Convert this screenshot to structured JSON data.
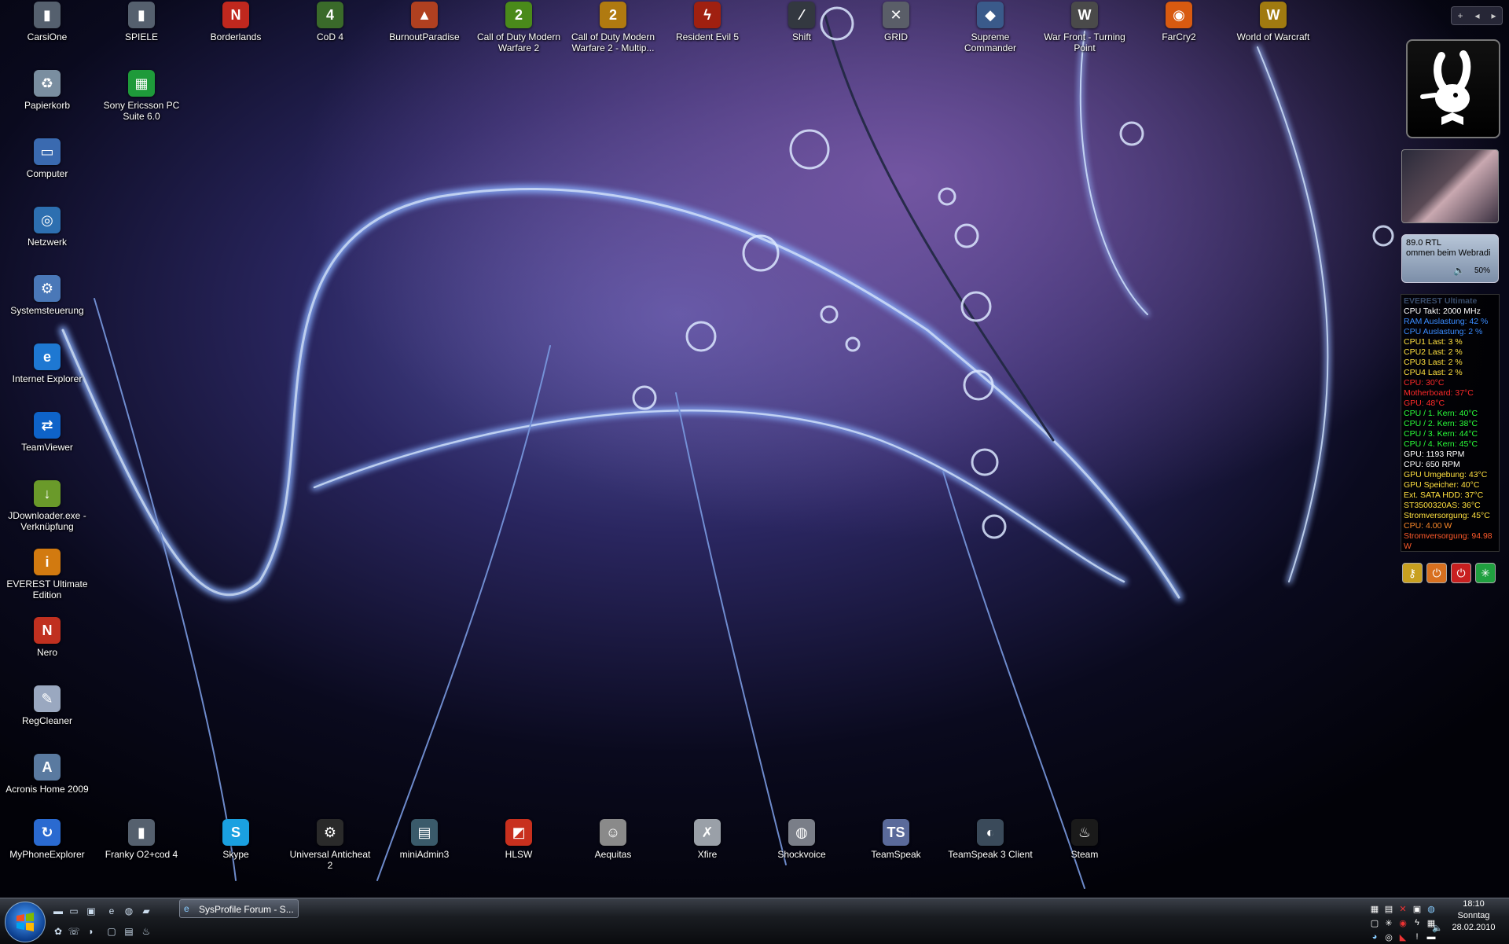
{
  "desktop": {
    "left_column": [
      {
        "label": "CarsiOne",
        "icon": "trash-bin-icon",
        "glyph": "▮",
        "color": "#55606e"
      },
      {
        "label": "Papierkorb",
        "icon": "recycle-bin-icon",
        "glyph": "♻",
        "color": "#7a8ea0"
      },
      {
        "label": "Computer",
        "icon": "computer-icon",
        "glyph": "▭",
        "color": "#3a6ab0"
      },
      {
        "label": "Netzwerk",
        "icon": "network-icon",
        "glyph": "◎",
        "color": "#2d6fb0"
      },
      {
        "label": "Systemsteuerung",
        "icon": "control-panel-icon",
        "glyph": "⚙",
        "color": "#4a78b8"
      },
      {
        "label": "Internet Explorer",
        "icon": "internet-explorer-icon",
        "glyph": "e",
        "color": "#1e78d2"
      },
      {
        "label": "TeamViewer",
        "icon": "teamviewer-icon",
        "glyph": "⇄",
        "color": "#0e63c8"
      },
      {
        "label": "JDownloader.exe - Verknüpfung",
        "icon": "jdownloader-icon",
        "glyph": "↓",
        "color": "#6a9a2a"
      },
      {
        "label": "EVEREST Ultimate Edition",
        "icon": "everest-icon",
        "glyph": "i",
        "color": "#d27a10"
      },
      {
        "label": "Nero",
        "icon": "nero-icon",
        "glyph": "N",
        "color": "#c03020"
      },
      {
        "label": "RegCleaner",
        "icon": "regcleaner-icon",
        "glyph": "✎",
        "color": "#9aa8c0"
      },
      {
        "label": "Acronis Home 2009",
        "icon": "acronis-icon",
        "glyph": "A",
        "color": "#5a7aa0"
      },
      {
        "label": "MyPhoneExplorer",
        "icon": "myphoneexplorer-icon",
        "glyph": "↻",
        "color": "#2a6ad0"
      }
    ],
    "second_column": [
      {
        "label": "SPIELE",
        "icon": "folder-icon",
        "glyph": "▮",
        "color": "#55606e"
      },
      {
        "label": "Sony Ericsson PC Suite 6.0",
        "icon": "sony-ericsson-icon",
        "glyph": "▦",
        "color": "#1e9a3a"
      }
    ],
    "top_row": [
      {
        "label": "Borderlands",
        "icon": "borderlands-icon",
        "glyph": "N",
        "color": "#c0281e"
      },
      {
        "label": "CoD 4",
        "icon": "cod4-icon",
        "glyph": "4",
        "color": "#3a6a2a"
      },
      {
        "label": "BurnoutParadise",
        "icon": "burnout-paradise-icon",
        "glyph": "▲",
        "color": "#b04020"
      },
      {
        "label": "Call of Duty Modern Warfare 2",
        "icon": "mw2-icon",
        "glyph": "2",
        "color": "#4a8a1a"
      },
      {
        "label": "Call of Duty Modern Warfare 2 - Multip...",
        "icon": "mw2-multiplayer-icon",
        "glyph": "2",
        "color": "#b07a10"
      },
      {
        "label": "Resident Evil 5",
        "icon": "resident-evil-5-icon",
        "glyph": "ϟ",
        "color": "#a02010"
      },
      {
        "label": "Shift",
        "icon": "shift-icon",
        "glyph": "⁄",
        "color": "#333840"
      },
      {
        "label": "GRID",
        "icon": "grid-icon",
        "glyph": "✕",
        "color": "#5a5e68"
      },
      {
        "label": "Supreme Commander",
        "icon": "supreme-commander-icon",
        "glyph": "◆",
        "color": "#3a5a8a"
      },
      {
        "label": "War Front - Turning Point",
        "icon": "war-front-icon",
        "glyph": "W",
        "color": "#4a4a4a"
      },
      {
        "label": "FarCry2",
        "icon": "farcry2-icon",
        "glyph": "◉",
        "color": "#d85a10"
      },
      {
        "label": "World of Warcraft",
        "icon": "world-of-warcraft-icon",
        "glyph": "W",
        "color": "#a07a10"
      }
    ],
    "bottom_row": [
      {
        "label": "Franky O2+cod 4",
        "icon": "folder-icon",
        "glyph": "▮",
        "color": "#55606e"
      },
      {
        "label": "Skype",
        "icon": "skype-icon",
        "glyph": "S",
        "color": "#1aa0e0"
      },
      {
        "label": "Universal Anticheat 2",
        "icon": "uac-icon",
        "glyph": "⚙",
        "color": "#2a2a2a"
      },
      {
        "label": "miniAdmin3",
        "icon": "miniadmin-icon",
        "glyph": "▤",
        "color": "#3a5a6a"
      },
      {
        "label": "HLSW",
        "icon": "hlsw-icon",
        "glyph": "◩",
        "color": "#c8301e"
      },
      {
        "label": "Aequitas",
        "icon": "aequitas-icon",
        "glyph": "☺",
        "color": "#8a8a8a"
      },
      {
        "label": "Xfire",
        "icon": "xfire-icon",
        "glyph": "✗",
        "color": "#9aa0a8"
      },
      {
        "label": "Shockvoice",
        "icon": "shockvoice-icon",
        "glyph": "◍",
        "color": "#7a7e88"
      },
      {
        "label": "TeamSpeak",
        "icon": "teamspeak-icon",
        "glyph": "TS",
        "color": "#5a6a9a"
      },
      {
        "label": "TeamSpeak 3 Client",
        "icon": "teamspeak3-icon",
        "glyph": "◐",
        "color": "#3a4a5a"
      },
      {
        "label": "Steam",
        "icon": "steam-icon",
        "glyph": "♨",
        "color": "#1a1a1a"
      }
    ]
  },
  "sidebar": {
    "controls": [
      "+",
      "◂",
      "▸"
    ],
    "radio": {
      "station": "89.0 RTL",
      "now_playing": "ommen beim Webradi",
      "volume": "50%"
    },
    "everest": {
      "title": "EVEREST Ultimate",
      "lines": [
        {
          "text": "CPU Takt: 2000 MHz",
          "color": "#ffffff"
        },
        {
          "text": "RAM Auslastung: 42 %",
          "color": "#3a8cff"
        },
        {
          "text": "CPU Auslastung: 2 %",
          "color": "#3a8cff"
        },
        {
          "text": "CPU1 Last: 3 %",
          "color": "#ffe040"
        },
        {
          "text": "CPU2 Last: 2 %",
          "color": "#ffe040"
        },
        {
          "text": "CPU3 Last: 2 %",
          "color": "#ffe040"
        },
        {
          "text": "CPU4 Last: 2 %",
          "color": "#ffe040"
        },
        {
          "text": "CPU: 30°C",
          "color": "#ff2a2a"
        },
        {
          "text": "Motherboard: 37°C",
          "color": "#ff2a2a"
        },
        {
          "text": "GPU: 48°C",
          "color": "#ff2a2a"
        },
        {
          "text": "CPU / 1. Kern: 40°C",
          "color": "#2aff3a"
        },
        {
          "text": "CPU / 2. Kern: 38°C",
          "color": "#2aff3a"
        },
        {
          "text": "CPU / 3. Kern: 44°C",
          "color": "#2aff3a"
        },
        {
          "text": "CPU / 4. Kern: 45°C",
          "color": "#2aff3a"
        },
        {
          "text": "GPU: 1193 RPM",
          "color": "#ffffff"
        },
        {
          "text": "CPU: 650 RPM",
          "color": "#ffffff"
        },
        {
          "text": "GPU Umgebung: 43°C",
          "color": "#ffe040"
        },
        {
          "text": "GPU Speicher: 40°C",
          "color": "#ffe040"
        },
        {
          "text": "Ext. SATA HDD: 37°C",
          "color": "#ffe040"
        },
        {
          "text": "ST3500320AS: 36°C",
          "color": "#ffe040"
        },
        {
          "text": "Stromversorgung: 45°C",
          "color": "#ffe040"
        },
        {
          "text": "CPU: 4.00 W",
          "color": "#ff8a2a"
        },
        {
          "text": "Stromversorgung: 94.98 W",
          "color": "#ff5a2a"
        }
      ]
    },
    "buttons": [
      {
        "icon": "key-icon",
        "glyph": "⚷",
        "color": "#c8a020"
      },
      {
        "icon": "power-icon",
        "glyph": "⏻",
        "color": "#d87020"
      },
      {
        "icon": "shutdown-icon",
        "glyph": "⏻",
        "color": "#c82020"
      },
      {
        "icon": "network-status-icon",
        "glyph": "✳",
        "color": "#20a040"
      }
    ]
  },
  "taskbar": {
    "window_button": "SysProfile Forum - S...",
    "clock": {
      "time": "18:10",
      "day": "Sonntag",
      "date": "28.02.2010"
    }
  }
}
